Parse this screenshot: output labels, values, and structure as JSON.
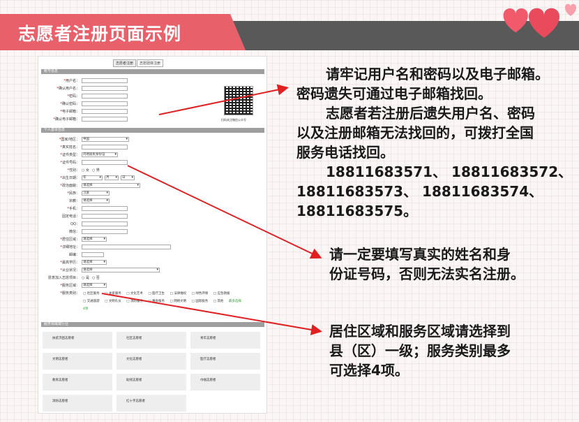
{
  "header": {
    "title": "志愿者注册页面示例"
  },
  "form": {
    "tabs": [
      "志愿者注册",
      "志愿团体注册"
    ],
    "section_account": "账号信息",
    "account_fields": [
      "用户名：",
      "确认用户名：",
      "密码：",
      "确认密码：",
      "电子邮箱：",
      "确认电子邮箱："
    ],
    "qr_caption": "扫码关注微信公众号",
    "section_personal": "个人基本信息",
    "country_label": "国家/地区：",
    "country_value": "中国",
    "realname_label": "真实姓名：",
    "idtype_label": "证件类型：",
    "idtype_value": "内地居民身份证",
    "idnum_label": "证件号码：",
    "gender_label": "性别：",
    "gender_female": "女",
    "gender_male": "男",
    "birth_label": "出生日期：",
    "birth_year": "年",
    "birth_month": "月",
    "birth_day": "日",
    "political_label": "政治面貌：",
    "select_placeholder": "请选择",
    "ethnic_label": "民族：",
    "ethnic_value": "汉族",
    "religion_label": "宗教：",
    "phone_label": "手机：",
    "tel_label": "固定电话：",
    "qq_label": "QQ：",
    "wechat_label": "微信：",
    "residence_label": "居住区域：",
    "address_label": "详细地址：",
    "postcode_label": "邮编：",
    "education_label": "最高学历：",
    "job_label": "从业状况：",
    "join_label": "愿意加入志愿项目：",
    "yes": "是",
    "no": "否",
    "service_area_label": "服务区域：",
    "service_type_label": "服务类别：",
    "service_types_row1": [
      "社区服务",
      "关爱服务",
      "文化艺术",
      "医疗卫生",
      "法律维权",
      "绿色环保",
      "应急救援"
    ],
    "service_types_row2": [
      "交通旅游",
      "文明礼仪",
      "消防服务",
      "赛会服务",
      "网络文明",
      "国际服务",
      "其他"
    ],
    "service_max_note": "最多选择",
    "service_max_num": "4项",
    "section_fields": "服务领域或行业",
    "tiles": [
      "扶贫济困志愿者",
      "社区志愿者",
      "青年志愿者",
      "文明志愿者",
      "文化志愿者",
      "医疗志愿者",
      "教育志愿者",
      "助残志愿者",
      "巾帼志愿者",
      "消防志愿者",
      "红十字志愿者"
    ]
  },
  "notes": {
    "n1": [
      "请牢记用户名和密码以及电子邮箱。",
      "密码遗失可通过电子邮箱找回。",
      "志愿者若注册后遗失用户名、密码",
      "以及注册邮箱无法找回的，可拨打全国",
      "服务电话找回。",
      "18811683571、 18811683572、",
      "18811683573、 18811683574、",
      "18811683575。"
    ],
    "n2": [
      "请一定要填写真实的姓名和身",
      "份证号码，否则无法实名注册。"
    ],
    "n3": [
      "居住区域和服务区域请选择到",
      "县（区）一级；服务类别最多",
      "可选择4项。"
    ]
  },
  "colors": {
    "title_bg": "#e8606a",
    "bar": "#595959",
    "arrow": "#e02020",
    "heart": "#f05a6a"
  }
}
